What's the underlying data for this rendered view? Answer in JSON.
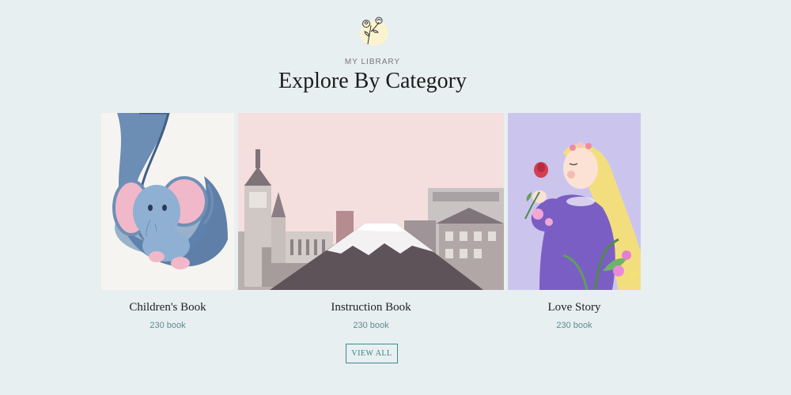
{
  "header": {
    "logo_icon": "rose-line-icon",
    "eyebrow": "MY LIBRARY",
    "title": "Explore By Category"
  },
  "categories": [
    {
      "name": "Children's Book",
      "count": "230 book",
      "image": "watercolor-elephant"
    },
    {
      "name": "Instruction Book",
      "count": "230 book",
      "image": "watercolor-city-mountain"
    },
    {
      "name": "Love Story",
      "count": "230 book",
      "image": "girl-smelling-rose"
    }
  ],
  "view_all_label": "VIEW ALL",
  "colors": {
    "background": "#e8eff1",
    "accent": "#3f8a8c",
    "count_text": "#5f8a90"
  }
}
